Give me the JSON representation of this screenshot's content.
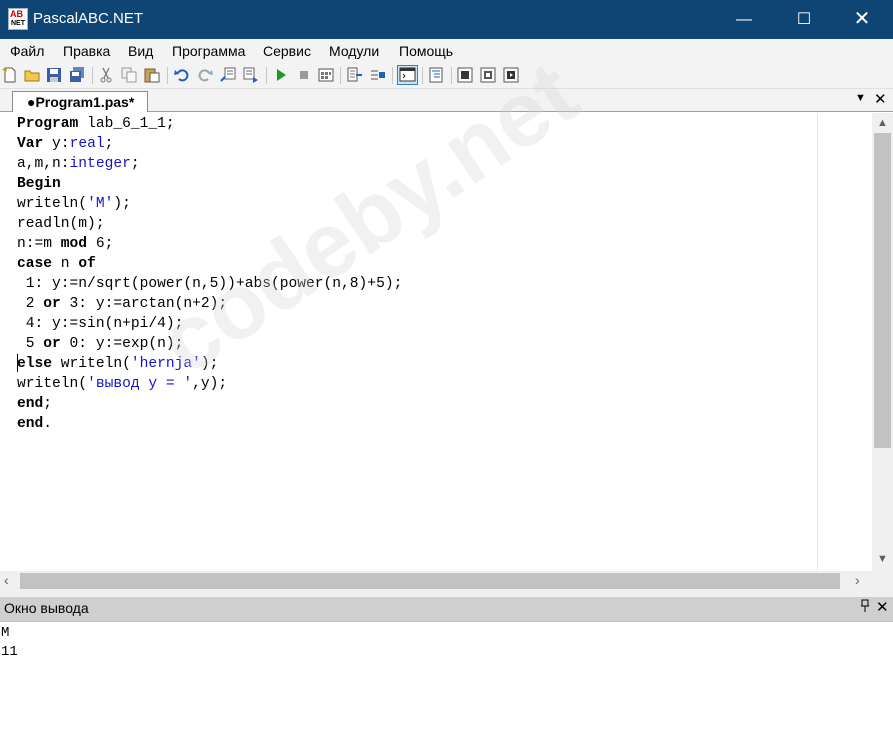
{
  "window": {
    "title": "PascalABC.NET",
    "icon_text_top": "AB",
    "icon_text_bottom": "NET",
    "minimize_glyph": "—",
    "maximize_glyph": "☐",
    "close_glyph": "✕"
  },
  "menu": {
    "items": [
      "Файл",
      "Правка",
      "Вид",
      "Программа",
      "Сервис",
      "Модули",
      "Помощь"
    ]
  },
  "toolbar": {
    "buttons": [
      {
        "name": "new-file",
        "icon": "new-file-icon"
      },
      {
        "name": "open-file",
        "icon": "open-folder-icon"
      },
      {
        "name": "save-file",
        "icon": "save-icon"
      },
      {
        "name": "save-all",
        "icon": "save-all-icon"
      },
      {
        "name": "cut",
        "icon": "scissors-icon"
      },
      {
        "name": "copy",
        "icon": "copy-icon"
      },
      {
        "name": "paste",
        "icon": "paste-icon"
      },
      {
        "name": "undo",
        "icon": "undo-icon"
      },
      {
        "name": "redo",
        "icon": "redo-icon"
      },
      {
        "name": "find",
        "icon": "find-icon"
      },
      {
        "name": "replace",
        "icon": "replace-icon"
      },
      {
        "name": "run",
        "icon": "play-icon"
      },
      {
        "name": "stop",
        "icon": "stop-icon"
      },
      {
        "name": "compile",
        "icon": "compile-icon"
      },
      {
        "name": "step-into",
        "icon": "step-into-icon"
      },
      {
        "name": "step-over",
        "icon": "step-over-icon"
      },
      {
        "name": "output-window",
        "icon": "console-icon"
      },
      {
        "name": "format-code",
        "icon": "format-icon"
      },
      {
        "name": "debug-1",
        "icon": "debug-icon"
      },
      {
        "name": "debug-2",
        "icon": "debug-icon"
      },
      {
        "name": "debug-3",
        "icon": "debug-icon"
      }
    ]
  },
  "tab": {
    "label": "●Program1.pas*",
    "dropdown_glyph": "▼",
    "close_glyph": "✕"
  },
  "editor": {
    "lines": [
      "Program lab_6_1_1;",
      "Var y:real;",
      "a,m,n:integer;",
      "Begin",
      "writeln('M');",
      "readln(m);",
      "n:=m mod 6;",
      "case n of",
      " 1: y:=n/sqrt(power(n,5))+abs(power(n,8)+5);",
      " 2 or 3: y:=arctan(n+2);",
      " 4: y:=sin(n+pi/4);",
      " 5 or 0: y:=exp(n);",
      "else writeln('hernja');",
      "writeln('вывод y = ',y);",
      "end;",
      "end."
    ],
    "watermark": "codeby.net",
    "colors": {
      "keyword": "#000000",
      "type": "#1515c8",
      "string": "#1515c8",
      "number": "#000000"
    }
  },
  "output": {
    "title": "Окно вывода",
    "pin_glyph": "📌",
    "close_glyph": "✕",
    "lines": [
      "M",
      "11"
    ]
  }
}
